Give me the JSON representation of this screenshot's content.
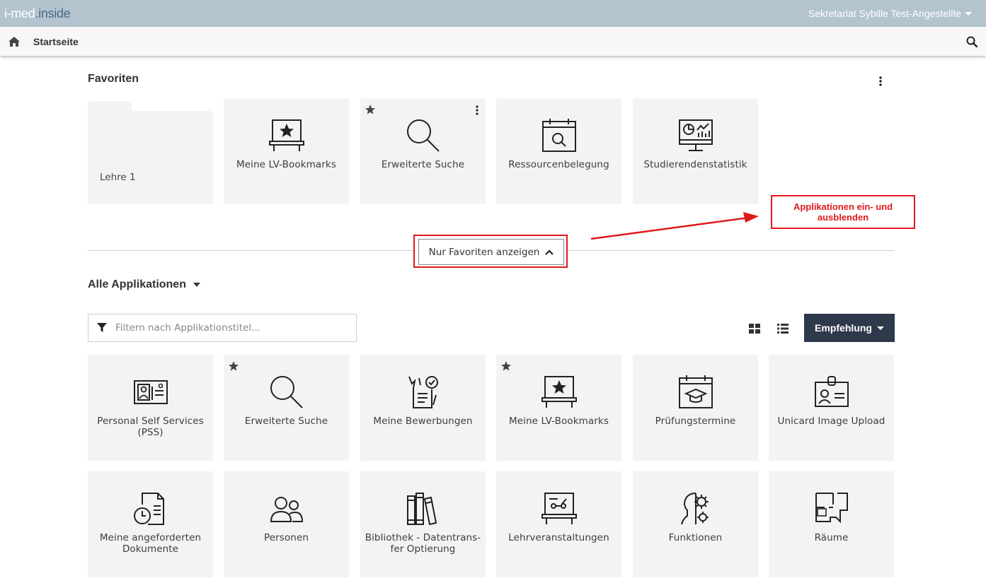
{
  "topbar": {
    "logo_left": "i-med",
    "logo_dot": ".",
    "logo_right": "inside",
    "user": "Sekretariat Sybille Test-Angestellte"
  },
  "navbar": {
    "title": "Startseite"
  },
  "favorites": {
    "heading": "Favoriten",
    "folder_label": "Lehre 1",
    "tiles": [
      {
        "label": "Meine LV-Bookmarks",
        "icon": "bookmark-board-icon"
      },
      {
        "label": "Erweiterte Suche",
        "icon": "magnifier-icon",
        "starred": true
      },
      {
        "label": "Ressourcenbelegung",
        "icon": "calendar-search-icon"
      },
      {
        "label": "Studierendenstatistik",
        "icon": "monitor-statistics-icon"
      }
    ]
  },
  "toggle": {
    "label": "Nur Favoriten anzeigen"
  },
  "annotation": {
    "line1": "Applikationen ein- und",
    "line2": "ausblenden"
  },
  "all_apps": {
    "heading": "Alle Applikationen",
    "filter_placeholder": "Filtern nach Applikationstitel...",
    "sort_button": "Empfehlung",
    "tiles_row1": [
      {
        "label1": "Personal Self Services",
        "label2": "(PSS)",
        "icon": "id-card-icon"
      },
      {
        "label1": "Erweiterte Suche",
        "label2": "",
        "icon": "magnifier-icon",
        "starred": true
      },
      {
        "label1": "Meine Bewerbungen",
        "label2": "",
        "icon": "application-document-icon"
      },
      {
        "label1": "Meine LV-Bookmarks",
        "label2": "",
        "icon": "bookmark-board-icon",
        "starred": true
      },
      {
        "label1": "Prüfungstermine",
        "label2": "",
        "icon": "calendar-graduation-icon"
      },
      {
        "label1": "Unicard Image Upload",
        "label2": "",
        "icon": "badge-icon"
      }
    ],
    "tiles_row2": [
      {
        "label1": "Meine angeforderten",
        "label2": "Dokumente",
        "icon": "document-clock-icon"
      },
      {
        "label1": "Personen",
        "label2": "",
        "icon": "people-icon"
      },
      {
        "label1": "Bibliothek - Datentrans-",
        "label2": "fer Optierung",
        "icon": "books-icon"
      },
      {
        "label1": "Lehrveranstaltungen",
        "label2": "",
        "icon": "lecture-board-icon"
      },
      {
        "label1": "Funktionen",
        "label2": "",
        "icon": "head-gear-icon"
      },
      {
        "label1": "Räume",
        "label2": "",
        "icon": "floorplan-icon"
      }
    ]
  }
}
